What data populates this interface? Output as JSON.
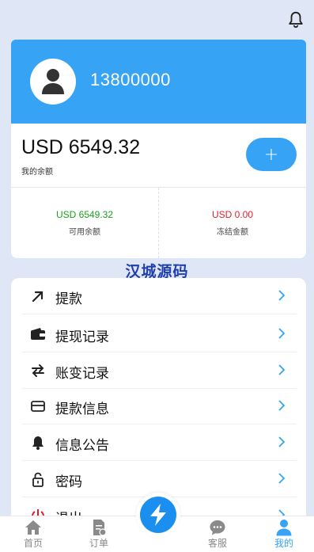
{
  "account": {
    "phone": "13800000"
  },
  "balance": {
    "amount": "USD 6549.32",
    "label": "我的余额",
    "add_label": "+",
    "available_amount": "USD 6549.32",
    "available_label": "可用余额",
    "frozen_amount": "USD 0.00",
    "frozen_label": "冻结金额"
  },
  "watermark": "汉城源码",
  "menu": {
    "items": [
      {
        "label": "提款",
        "icon": "arrow-up-right-icon"
      },
      {
        "label": "提现记录",
        "icon": "wallet-icon"
      },
      {
        "label": "账变记录",
        "icon": "swap-icon"
      },
      {
        "label": "提款信息",
        "icon": "card-icon"
      },
      {
        "label": "信息公告",
        "icon": "bell-icon"
      },
      {
        "label": "密码",
        "icon": "lock-icon"
      },
      {
        "label": "退出",
        "icon": "power-icon"
      }
    ]
  },
  "tabbar": {
    "items": [
      {
        "label": "首页",
        "icon": "home-icon"
      },
      {
        "label": "订单",
        "icon": "order-icon"
      },
      {
        "label": "客服",
        "icon": "chat-icon"
      },
      {
        "label": "我的",
        "icon": "user-icon"
      }
    ],
    "active": "我的"
  },
  "colors": {
    "accent": "#37a3f5",
    "available": "#1aa11a",
    "frozen": "#e0202a",
    "watermark": "#1f3fae"
  }
}
